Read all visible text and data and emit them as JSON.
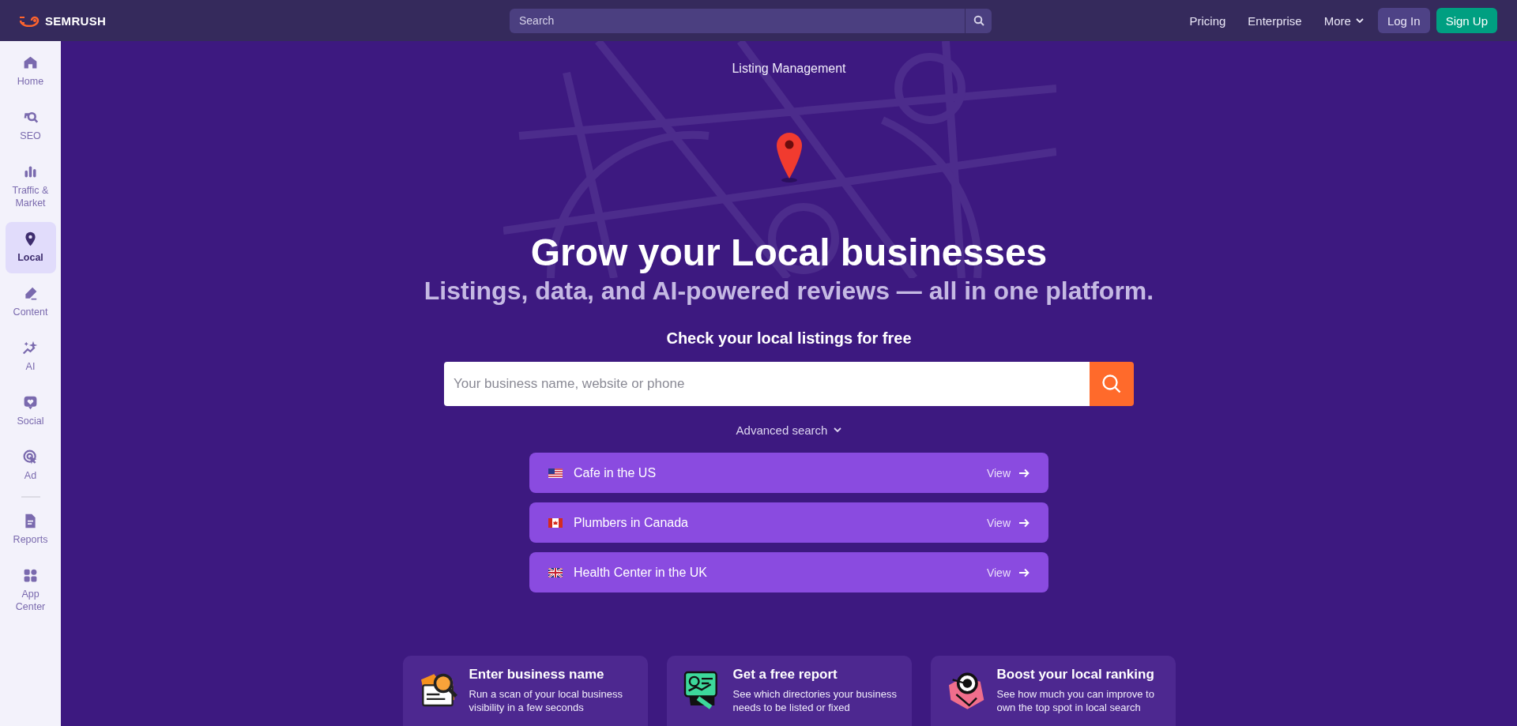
{
  "topbar": {
    "logo": "SEMRUSH",
    "search": {
      "placeholder": "Search"
    },
    "nav": [
      {
        "label": "Pricing",
        "has_menu": false
      },
      {
        "label": "Enterprise",
        "has_menu": false
      },
      {
        "label": "More",
        "has_menu": true
      }
    ],
    "buttons": [
      {
        "label": "Log In",
        "kind": "secondary"
      },
      {
        "label": "Sign Up",
        "kind": "primary"
      }
    ]
  },
  "sidebar": {
    "items": [
      {
        "label": "Home",
        "selected": false
      },
      {
        "label": "SEO",
        "selected": false
      },
      {
        "label": "Traffic & Market",
        "selected": false
      },
      {
        "label": "Local",
        "selected": true
      },
      {
        "label": "Content",
        "selected": false
      },
      {
        "label": "AI",
        "selected": false
      },
      {
        "label": "Social",
        "selected": false
      },
      {
        "label": "Ad",
        "selected": false
      }
    ],
    "bottom_items": [
      {
        "label": "Reports",
        "selected": false
      },
      {
        "label": "App Center",
        "selected": false
      }
    ]
  },
  "hero": {
    "eyebrow": "Listing Management",
    "title": "Grow your Local businesses",
    "subtitle": "Listings, data, and AI-powered reviews — all in one platform.",
    "check_title": "Check your local listings for free",
    "search": {
      "placeholder": "Your business name, website or phone"
    },
    "advanced": "Advanced search"
  },
  "examples": [
    {
      "label": "Cafe in the US",
      "action": "View"
    },
    {
      "label": "Plumbers in Canada",
      "action": "View"
    },
    {
      "label": "Health Center in the UK",
      "action": "View"
    }
  ],
  "steps": [
    {
      "title": "Enter business name",
      "text": "Run a scan of your local business visibility in a few seconds"
    },
    {
      "title": "Get a free report",
      "text": "See which directories your business needs to be listed or fixed"
    },
    {
      "title": "Boost your local ranking",
      "text": "See how much you can improve to own the top spot in local search"
    }
  ]
}
